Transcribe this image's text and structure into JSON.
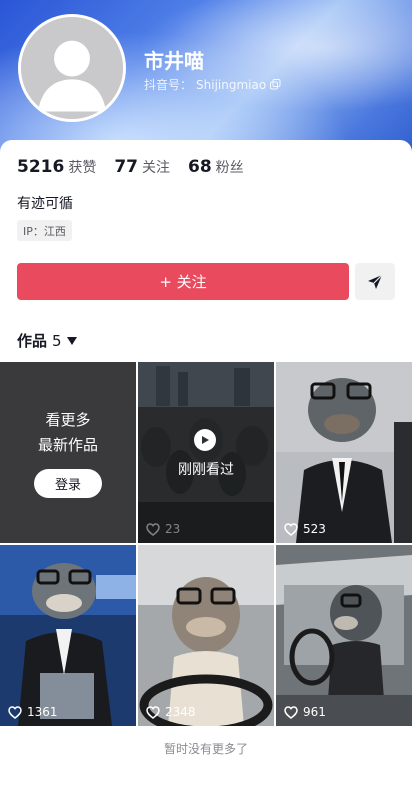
{
  "profile": {
    "nickname": "市井喵",
    "account_label": "抖音号：",
    "account_id": "Shijingmiao",
    "bio": "有迹可循",
    "ip": "IP：江西"
  },
  "stats": [
    {
      "value": "5216",
      "label": "获赞"
    },
    {
      "value": "77",
      "label": "关注"
    },
    {
      "value": "68",
      "label": "粉丝"
    }
  ],
  "actions": {
    "follow_label": "+ 关注",
    "share_icon": "send-icon"
  },
  "works": {
    "tab_label": "作品",
    "count": "5"
  },
  "grid": {
    "cta": {
      "line1": "看更多",
      "line2": "最新作品",
      "login": "登录"
    },
    "recent": {
      "label": "刚刚看过",
      "likes": "23"
    },
    "items": [
      {
        "likes": "523"
      },
      {
        "likes": "1361"
      },
      {
        "likes": "2348"
      },
      {
        "likes": "961"
      }
    ]
  },
  "footer": "暂时没有更多了",
  "colors": {
    "accent": "#ea4a5e",
    "header_blue": "#2a56d6"
  }
}
